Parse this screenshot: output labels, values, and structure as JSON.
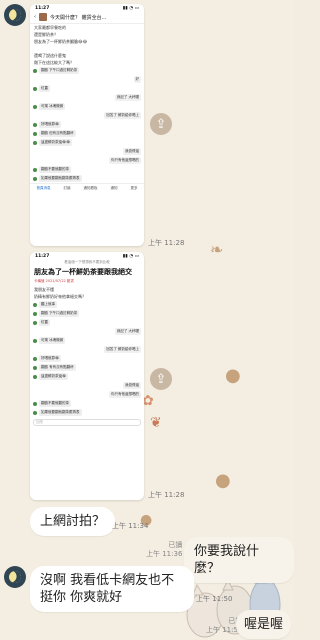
{
  "chat": {
    "messages_time_1": "上午 11:28",
    "messages_time_2": "上午 11:28",
    "bubble1": "上網討拍？",
    "bubble1_time": "上午 11:34",
    "my_bubble1": "你要我說什麼？",
    "my_read1": "已讀",
    "my_time1": "上午 11:36",
    "bubble2": "沒啊 我看低卡網友也不挺你 你爽就好",
    "bubble2_time": "上午 11:50",
    "my_bubble2": "喔是喔",
    "my_read2": "已讀",
    "my_time2": "上午 11:51"
  },
  "screenshot1": {
    "status_time": "11:27",
    "title": "今天開什麼？ 雜貨全台...",
    "intro": [
      "大家最都早餐吃的",
      "還是鮮奶茶？",
      "朋友為了一杯鮮奶茶翻臉😂😂",
      "",
      "還喝了說這什麼鬼",
      "剛下在這比較大了嗎？"
    ],
    "rows": [
      {
        "side": "left",
        "text": "翻臉 下午口過訂鮮奶茶"
      },
      {
        "side": "right",
        "text": "好"
      },
      {
        "side": "left",
        "text": "紅蓋"
      },
      {
        "side": "right",
        "text": "我記了 大杯喔"
      },
      {
        "side": "left",
        "text": "可樂 冰塊微微"
      },
      {
        "side": "right",
        "text": "回答了 鮮奶給你喝上"
      },
      {
        "side": "left",
        "text": "好喝就算😂"
      },
      {
        "side": "left",
        "text": "翻臉 但有沒有點翻杯"
      },
      {
        "side": "left",
        "text": "這邊鮮奶茶還😂😂"
      },
      {
        "side": "right",
        "text": "我覺得還"
      },
      {
        "side": "right",
        "text": "你只有他還想喝的"
      },
      {
        "side": "left",
        "text": "翻臉不要就翻的茶"
      },
      {
        "side": "left",
        "text": "如果就要翻就翻茶跟再表"
      }
    ],
    "nav": [
      "首頁消息",
      "討論",
      "通知看板",
      "通知",
      "更多"
    ]
  },
  "screenshot2": {
    "status_time": "11:27",
    "subtitle": "看這個一下想想我不要到比較",
    "headline": "朋友為了一杯鮮奶茶要跟我絕交",
    "meta": "卡稱值  2021/07/22  臉書",
    "body": [
      "我朋友不懂",
      "奶精有鮮奶好來他拿絕交嗎？"
    ],
    "rows": [
      {
        "side": "left",
        "text": "聽上就事"
      },
      {
        "side": "left",
        "text": "翻臉 下午口過訂鮮奶茶"
      },
      {
        "side": "left",
        "text": "紅蓋"
      },
      {
        "side": "right",
        "text": "我記了 大杯喔"
      },
      {
        "side": "left",
        "text": "可樂 冰塊微微"
      },
      {
        "side": "right",
        "text": "回答了 鮮奶給你喝上"
      },
      {
        "side": "left",
        "text": "好喝就算😂"
      },
      {
        "side": "left",
        "text": "翻臉 有有沒有點翻杯"
      },
      {
        "side": "left",
        "text": "這邊鮮奶茶還😂"
      },
      {
        "side": "right",
        "text": "我覺得還"
      },
      {
        "side": "right",
        "text": "你只有他還想喝的"
      },
      {
        "side": "left",
        "text": "翻臉不要就翻的茶"
      },
      {
        "side": "left",
        "text": "如果就要翻就翻茶跟再表"
      }
    ],
    "input_placeholder": "回應"
  }
}
